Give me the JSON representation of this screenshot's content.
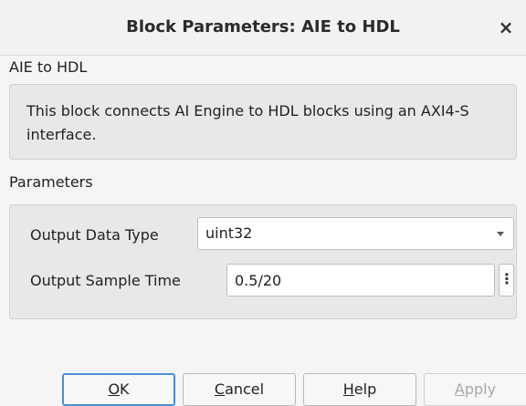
{
  "window": {
    "title": "Block Parameters: AIE to HDL",
    "close_glyph": "×"
  },
  "block": {
    "name": "AIE to HDL",
    "description": "This block connects AI Engine to HDL blocks using an AXI4-S interface."
  },
  "parameters": {
    "section_label": "Parameters",
    "output_data_type": {
      "label": "Output Data Type",
      "value": "uint32"
    },
    "output_sample_time": {
      "label": "Output Sample Time",
      "value": "0.5/20",
      "more_glyph": "⋮"
    }
  },
  "buttons": {
    "ok": {
      "mnemonic": "O",
      "rest": "K"
    },
    "cancel": {
      "mnemonic": "C",
      "rest": "ancel"
    },
    "help": {
      "mnemonic": "H",
      "rest": "elp"
    },
    "apply": {
      "mnemonic": "A",
      "rest": "pply"
    }
  }
}
